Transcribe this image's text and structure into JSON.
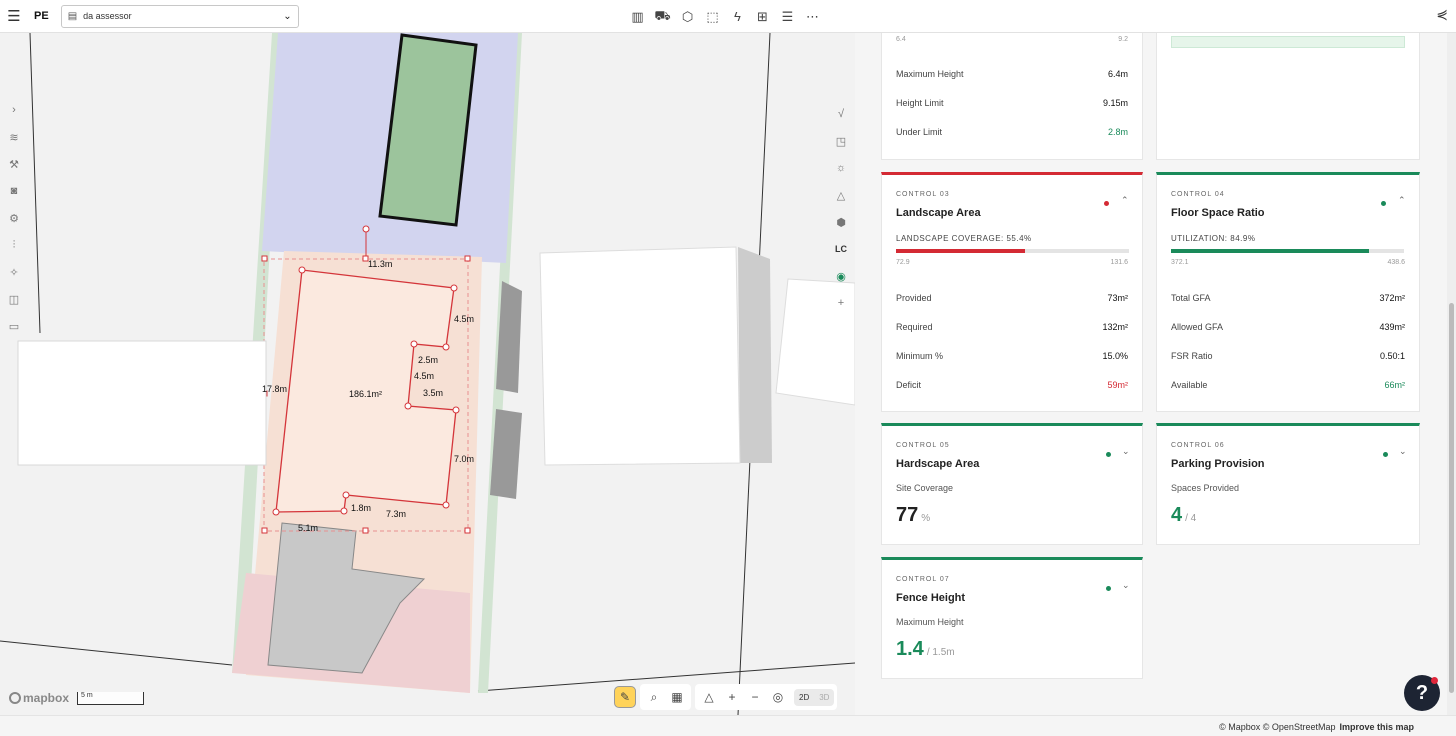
{
  "header": {
    "brand": "PE",
    "project_name": "da assessor",
    "toolbar_icons": [
      "building-icon",
      "truck-icon",
      "shield-icon",
      "frame-icon",
      "lightning-icon",
      "ruler-icon",
      "layers-icon",
      "more-icon"
    ],
    "share_icon": "share-icon"
  },
  "map": {
    "labels": {
      "top_edge": "11.3m",
      "right_upper": "4.5m",
      "notch_top": "2.5m",
      "notch_side": "4.5m",
      "notch_bottom": "3.5m",
      "left_edge": "17.8m",
      "area": "186.1m²",
      "right_lower": "7.0m",
      "bottom_left": "5.1m",
      "bottom_notch": "1.8m",
      "bottom_right": "7.3m"
    },
    "right_rail_lc": "LC",
    "scale_label": "5 m",
    "mapbox_label": "mapbox",
    "view_2d": "2D",
    "view_3d": "3D"
  },
  "height_card": {
    "bar_min": "6.4",
    "bar_max": "9.2",
    "rows": [
      {
        "label": "Maximum Height",
        "value": "6.4m"
      },
      {
        "label": "Height Limit",
        "value": "9.15m"
      },
      {
        "label": "Under Limit",
        "value": "2.8m"
      }
    ]
  },
  "landscape": {
    "control": "CONTROL 03",
    "title": "Landscape Area",
    "coverage_label": "LANDSCAPE COVERAGE: 55.4%",
    "fill_fraction": 0.554,
    "bar_min": "72.9",
    "bar_max": "131.6",
    "rows": [
      {
        "label": "Provided",
        "value": "73m²"
      },
      {
        "label": "Required",
        "value": "132m²"
      },
      {
        "label": "Minimum %",
        "value": "15.0%"
      },
      {
        "label": "Deficit",
        "value": "59m²"
      }
    ]
  },
  "fsr": {
    "control": "CONTROL 04",
    "title": "Floor Space Ratio",
    "util_label": "UTILIZATION: 84.9%",
    "fill_fraction": 0.849,
    "bar_min": "372.1",
    "bar_max": "438.6",
    "rows": [
      {
        "label": "Total GFA",
        "value": "372m²"
      },
      {
        "label": "Allowed GFA",
        "value": "439m²"
      },
      {
        "label": "FSR Ratio",
        "value": "0.50:1"
      },
      {
        "label": "Available",
        "value": "66m²"
      }
    ]
  },
  "hardscape": {
    "control": "CONTROL 05",
    "title": "Hardscape Area",
    "sub_label": "Site Coverage",
    "value": "77",
    "suffix": "%"
  },
  "parking": {
    "control": "CONTROL 06",
    "title": "Parking Provision",
    "sub_label": "Spaces Provided",
    "value": "4",
    "suffix": "/ 4"
  },
  "fence": {
    "control": "CONTROL 07",
    "title": "Fence Height",
    "sub_label": "Maximum Height",
    "value": "1.4",
    "suffix": "/ 1.5m"
  },
  "footer": {
    "attribution": "© Mapbox © OpenStreetMap",
    "improve": "Improve this map"
  },
  "colors": {
    "green": "#1a8a5a",
    "red": "#d42a34"
  }
}
